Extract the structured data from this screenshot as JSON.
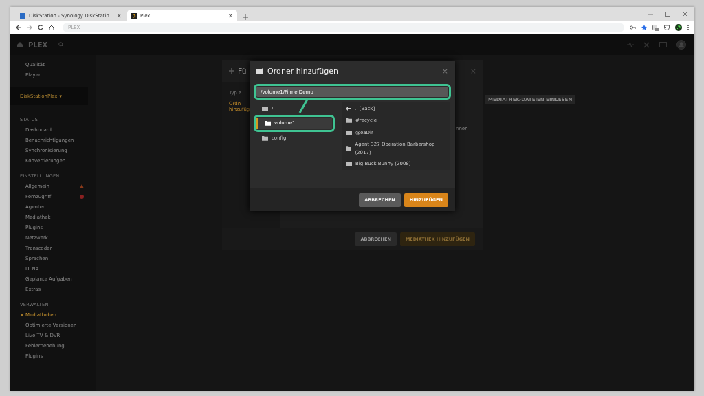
{
  "browser": {
    "tabs": [
      {
        "title": "DiskStation - Synology DiskStatio",
        "close": "✕",
        "selected": false
      },
      {
        "title": "Plex",
        "close": "✕",
        "selected": true
      }
    ],
    "address": "PLEX"
  },
  "plex_header": {
    "logo": "PLEX"
  },
  "sidebar": {
    "items": [
      {
        "kind": "item",
        "label": "Qualität",
        "selected": false
      },
      {
        "kind": "item",
        "label": "Player",
        "selected": false
      },
      {
        "kind": "server",
        "label": "DiskStationPlex",
        "caret": "▾"
      },
      {
        "kind": "heading",
        "label": "STATUS"
      },
      {
        "kind": "item",
        "label": "Dashboard",
        "selected": false
      },
      {
        "kind": "item",
        "label": "Benachrichtigungen",
        "selected": false
      },
      {
        "kind": "item",
        "label": "Synchronisierung",
        "selected": false
      },
      {
        "kind": "item",
        "label": "Konvertierungen",
        "selected": false
      },
      {
        "kind": "heading",
        "label": "EINSTELLUNGEN"
      },
      {
        "kind": "item",
        "label": "Allgemein",
        "selected": false,
        "warning": true
      },
      {
        "kind": "item",
        "label": "Fernzugriff",
        "selected": false,
        "error": true
      },
      {
        "kind": "item",
        "label": "Agenten",
        "selected": false
      },
      {
        "kind": "item",
        "label": "Mediathek",
        "selected": false
      },
      {
        "kind": "item",
        "label": "Plugins",
        "selected": false
      },
      {
        "kind": "item",
        "label": "Netzwerk",
        "selected": false
      },
      {
        "kind": "item",
        "label": "Transcoder",
        "selected": false
      },
      {
        "kind": "item",
        "label": "Sprachen",
        "selected": false
      },
      {
        "kind": "item",
        "label": "DLNA",
        "selected": false
      },
      {
        "kind": "item",
        "label": "Geplante Aufgaben",
        "selected": false
      },
      {
        "kind": "item",
        "label": "Extras",
        "selected": false
      },
      {
        "kind": "heading",
        "label": "VERWALTEN"
      },
      {
        "kind": "item",
        "label": "Mediatheken",
        "selected": true
      },
      {
        "kind": "item",
        "label": "Optimierte Versionen",
        "selected": false
      },
      {
        "kind": "item",
        "label": "Live TV & DVR",
        "selected": false
      },
      {
        "kind": "item",
        "label": "Fehlerbehebung",
        "selected": false
      },
      {
        "kind": "item",
        "label": "Plugins",
        "selected": false
      }
    ]
  },
  "page_button": "MEDIATHEK-DATEIEN EINLESEN",
  "background_dialog": {
    "title": "Fü",
    "close": "×",
    "steps": [
      {
        "label": "Typ a",
        "selected": false
      },
      {
        "label": "Ordn\nhinzufüg",
        "selected": true
      }
    ],
    "text_fragment": "nner",
    "buttons": [
      {
        "label": "ABBRECHEN",
        "kind": "secondary",
        "disabled": false
      },
      {
        "label": "MEDIATHEK HINZUFÜGEN",
        "kind": "primary",
        "disabled": true
      }
    ]
  },
  "folder_dialog": {
    "title": "Ordner hinzufügen",
    "close": "×",
    "path": "/volume1/Filme Demo",
    "folders": [
      {
        "name": "/",
        "selected": false
      },
      {
        "name": "volume1",
        "selected": true
      },
      {
        "name": "config",
        "selected": false
      }
    ],
    "entries": [
      {
        "kind": "back",
        "name": ".. [Back]"
      },
      {
        "kind": "folder",
        "name": "#recycle"
      },
      {
        "kind": "folder",
        "name": "@eaDir"
      },
      {
        "kind": "folder",
        "name": "Agent 327 Operation Barbershop (2017)"
      },
      {
        "kind": "folder",
        "name": "Big Buck Bunny (2008)"
      }
    ],
    "buttons": [
      {
        "label": "ABBRECHEN",
        "kind": "secondary",
        "disabled": false
      },
      {
        "label": "HINZUFÜGEN",
        "kind": "primary",
        "disabled": false
      }
    ]
  }
}
